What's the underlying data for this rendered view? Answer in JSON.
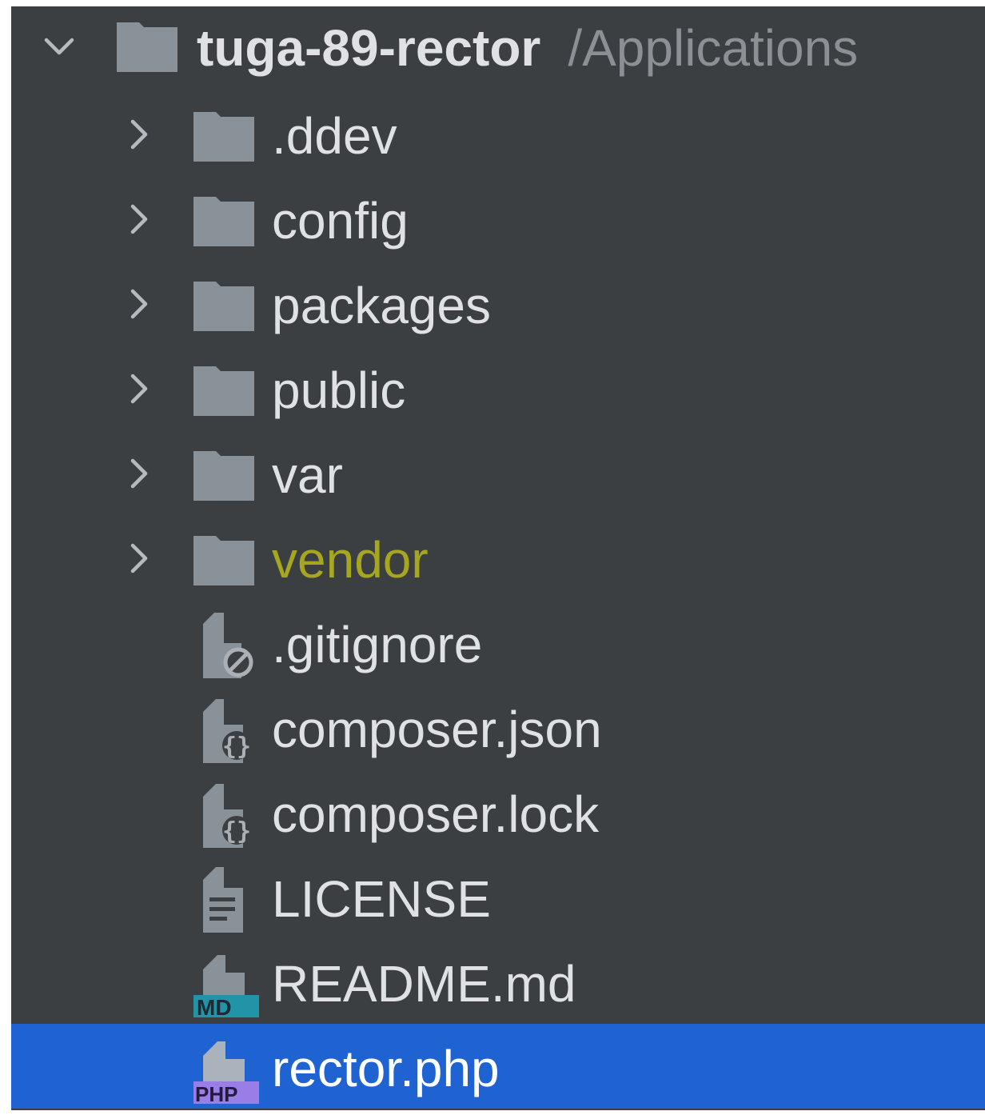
{
  "tree": {
    "root": {
      "name": "tuga-89-rector",
      "path": "/Applications",
      "expanded": true
    },
    "folders": [
      {
        "label": ".ddev"
      },
      {
        "label": "config"
      },
      {
        "label": "packages"
      },
      {
        "label": "public"
      },
      {
        "label": "var"
      },
      {
        "label": "vendor",
        "color": "#a6a61f"
      }
    ],
    "files": [
      {
        "label": ".gitignore",
        "icon": "gitignore-file-icon"
      },
      {
        "label": "composer.json",
        "icon": "json-file-icon"
      },
      {
        "label": "composer.lock",
        "icon": "json-file-icon"
      },
      {
        "label": "LICENSE",
        "icon": "text-file-icon"
      },
      {
        "label": "README.md",
        "icon": "markdown-file-icon",
        "badge": "MD"
      },
      {
        "label": "rector.php",
        "icon": "php-file-icon",
        "badge": "PHP",
        "selected": true
      }
    ]
  },
  "colors": {
    "background": "#3c3f41",
    "text": "#dfe1e5",
    "muted": "#8c8f93",
    "selection": "#1f63d3",
    "ignored": "#a6a61f",
    "folder": "#8a9299"
  }
}
